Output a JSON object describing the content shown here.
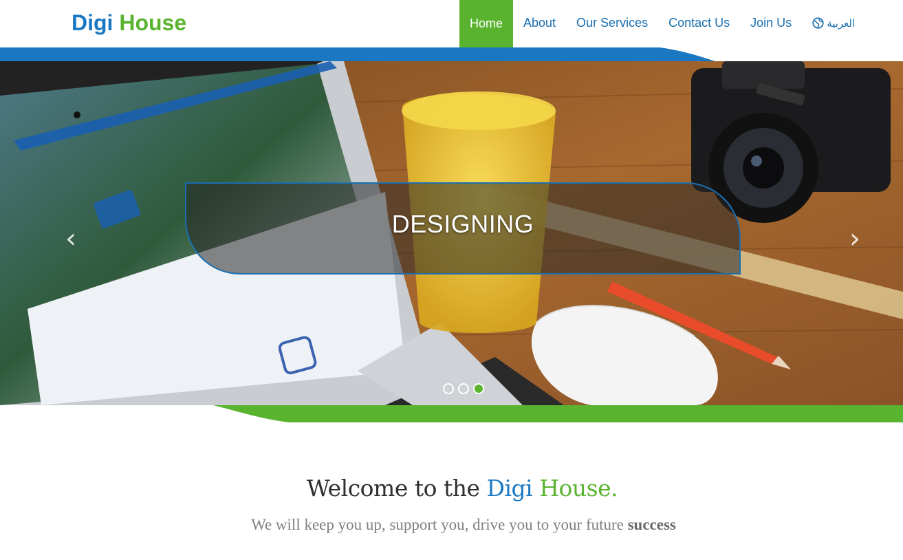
{
  "brand": {
    "name_part1": "Digi",
    "name_part2": "House",
    "color_blue": "#1a78c2",
    "color_green": "#5ab32f"
  },
  "nav": {
    "items": [
      {
        "label": "Home",
        "active": true
      },
      {
        "label": "About",
        "active": false
      },
      {
        "label": "Our Services",
        "active": false
      },
      {
        "label": "Contact Us",
        "active": false
      },
      {
        "label": "Join Us",
        "active": false
      }
    ],
    "language": {
      "label": "العربية",
      "icon": "globe-icon"
    }
  },
  "hero": {
    "caption": "DESIGNING",
    "prev_icon": "chevron-left-icon",
    "next_icon": "chevron-right-icon",
    "slide_count": 3,
    "active_slide": 3
  },
  "welcome": {
    "title_prefix": "Welcome to the",
    "title_word1": "Digi",
    "title_word2": "House.",
    "subtitle_main": "We will keep you up, support you, drive you to your future",
    "subtitle_bold": "success"
  }
}
